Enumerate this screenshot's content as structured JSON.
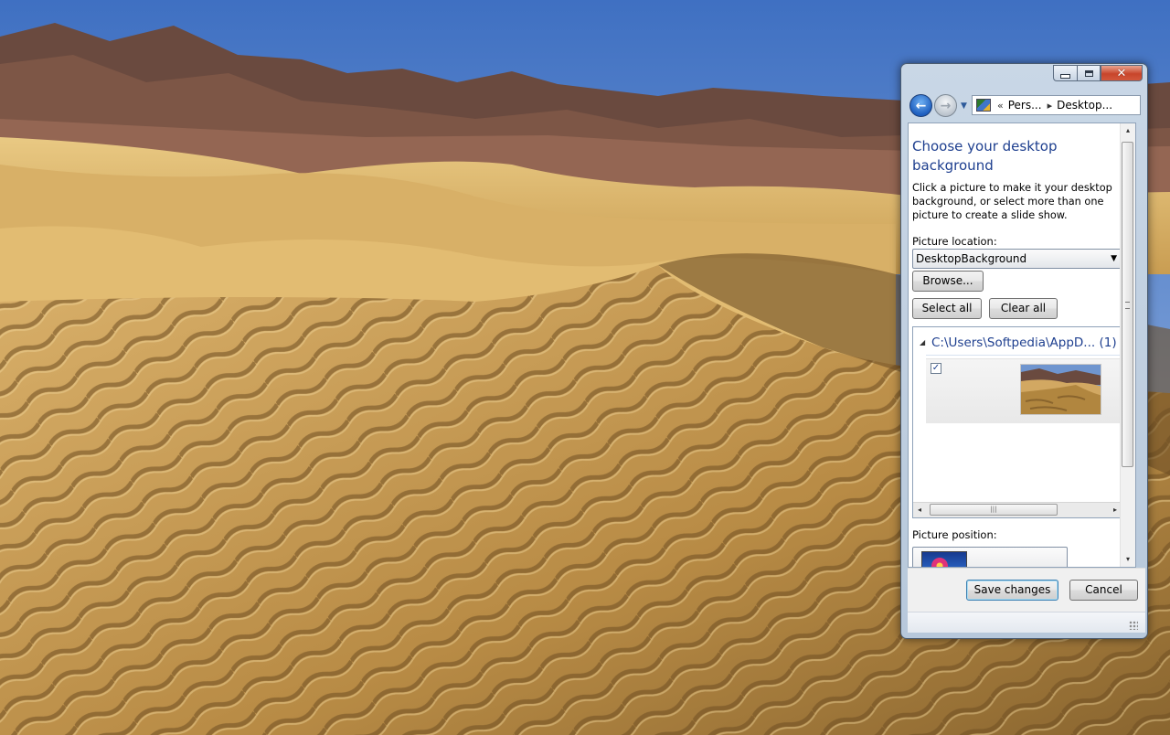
{
  "desktop": {
    "wallpaper": "desert-dunes-wallpaper",
    "colors": {
      "sky": "#5e8bcf",
      "sand_light": "#e7c27a",
      "sand_dark": "#8a6a35",
      "mountains": "#6b4a3e"
    }
  },
  "window": {
    "navigation": {
      "breadcrumb": [
        {
          "label": "Pers..."
        },
        {
          "label": "Desktop..."
        }
      ],
      "overflow_label": "«",
      "separator": "▸"
    },
    "title": "Choose your desktop background",
    "description": "Click a picture to make it your desktop background, or select more than one picture to create a slide show.",
    "picture_location": {
      "label": "Picture location:",
      "value": "DesktopBackground"
    },
    "buttons": {
      "browse": "Browse...",
      "select_all": "Select all",
      "clear_all": "Clear all",
      "save": "Save changes",
      "cancel": "Cancel"
    },
    "picture_group": {
      "toggle": "◢",
      "label": "C:\\Users\\Softpedia\\AppD... (1)",
      "items": [
        {
          "checked": true,
          "check_glyph": "✓",
          "thumbnail": "desert-dunes-thumbnail"
        }
      ]
    },
    "picture_position": {
      "label": "Picture position:"
    },
    "scroll_glyphs": {
      "left": "◂",
      "right": "▸",
      "up": "▴",
      "down": "▾",
      "grip": "|||"
    },
    "caption_glyphs": {
      "close": "✕"
    },
    "accent": "#1e3f8f"
  }
}
